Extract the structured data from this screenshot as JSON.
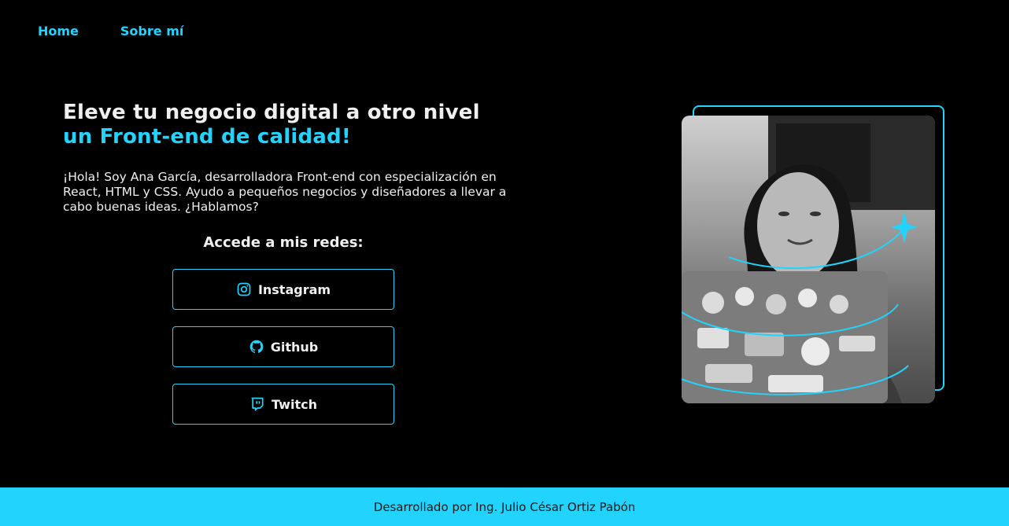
{
  "nav": {
    "items": [
      {
        "label": "Home"
      },
      {
        "label": "Sobre mí"
      }
    ]
  },
  "hero": {
    "headline_line1": "Eleve tu negocio digital a otro nivel",
    "headline_line2": "un Front-end de calidad!",
    "intro": "¡Hola! Soy Ana García, desarrolladora Front-end con especialización en React, HTML y CSS. Ayudo a pequeños negocios y diseñadores a llevar a cabo buenas ideas. ¿Hablamos?"
  },
  "social": {
    "title": "Accede a mis redes:",
    "buttons": [
      {
        "label": "Instagram",
        "icon": "instagram-icon"
      },
      {
        "label": "Github",
        "icon": "github-icon"
      },
      {
        "label": "Twitch",
        "icon": "twitch-icon"
      }
    ]
  },
  "footer": {
    "text": "Desarrollado por Ing. Julio César Ortiz Pabón"
  },
  "colors": {
    "accent": "#22d4fd",
    "background": "#000000",
    "text": "#f0f0f0"
  }
}
